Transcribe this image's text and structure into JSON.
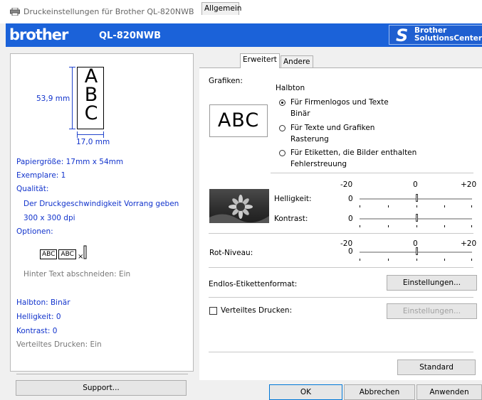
{
  "window": {
    "title": "Druckeinstellungen für Brother QL-820NWB",
    "app_icon": "printer-icon"
  },
  "brand": {
    "logo": "brother",
    "model": "QL-820NWB",
    "solutions_line1": "Brother",
    "solutions_line2": "SolutionsCenter",
    "solutions_icon": "s-swoosh-icon"
  },
  "preview": {
    "letters": "A\nB\nC",
    "height_label": "53,9 mm",
    "width_label": "17,0 mm"
  },
  "summary": {
    "paper": "Papiergröße: 17mm x 54mm",
    "copies": "Exemplare: 1",
    "quality_label": "Qualität:",
    "quality_value1": "Der Druckgeschwindigkeit Vorrang geben",
    "quality_value2": "300 x 300 dpi",
    "options_label": "Optionen:",
    "option_abc1": "ABC",
    "option_abc2": "ABC",
    "cut_text": "Hinter Text abschneiden: Ein",
    "halftone": "Halbton: Binär",
    "brightness": "Helligkeit:  0",
    "contrast": "Kontrast:  0",
    "distributed": "Verteiltes Drucken: Ein"
  },
  "support_button": "Support...",
  "tabs": [
    {
      "label": "Allgemein",
      "active": false
    },
    {
      "label": "Erweitert",
      "active": true
    },
    {
      "label": "Andere",
      "active": false
    }
  ],
  "graphics": {
    "label": "Grafiken:",
    "sample": "ABC",
    "halftone_title": "Halbton",
    "options": [
      {
        "line1": "Für Firmenlogos und Texte",
        "line2": "Binär",
        "selected": true
      },
      {
        "line1": "Für Texte und Grafiken",
        "line2": "Rasterung",
        "selected": false
      },
      {
        "line1": "Für Etiketten, die Bilder enthalten",
        "line2": "Fehlerstreuung",
        "selected": false
      }
    ]
  },
  "sliders": {
    "scale_min": "-20",
    "scale_mid": "0",
    "scale_max": "+20",
    "brightness": {
      "label": "Helligkeit:",
      "value": "0",
      "level": 0
    },
    "contrast": {
      "label": "Kontrast:",
      "value": "0",
      "level": 0
    },
    "red_level": {
      "label": "Rot-Niveau:",
      "value": "0",
      "level": 0
    }
  },
  "endless": {
    "label": "Endlos-Etikettenformat:",
    "button": "Einstellungen..."
  },
  "distributed": {
    "label": "Verteiltes Drucken:",
    "checked": false,
    "button": "Einstellungen..."
  },
  "standard_button": "Standard",
  "footer": {
    "ok": "OK",
    "cancel": "Abbrechen",
    "apply": "Anwenden"
  },
  "colors": {
    "brand_blue": "#1b62d9",
    "link_blue": "#1133cc"
  }
}
